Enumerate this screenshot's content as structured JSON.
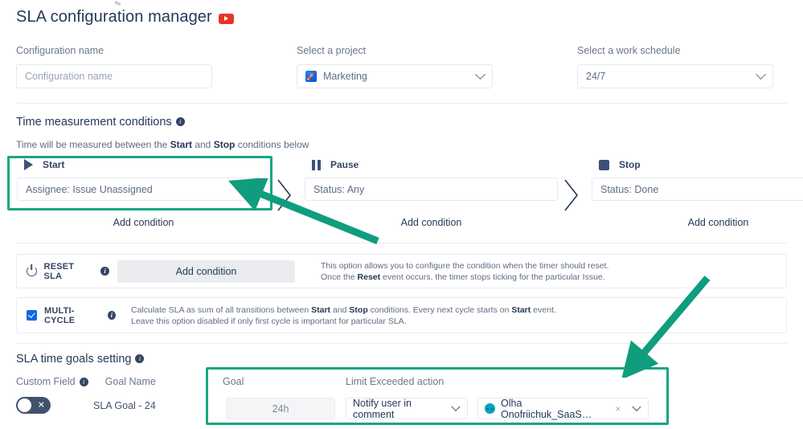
{
  "header": {
    "title": "SLA configuration manager",
    "video_icon": "youtube-icon"
  },
  "fields": {
    "configuration": {
      "label": "Configuration name",
      "placeholder": "Configuration name",
      "value": ""
    },
    "project": {
      "label": "Select a project",
      "value": "Marketing",
      "icon": "rocket-icon"
    },
    "schedule": {
      "label": "Select a work schedule",
      "value": "24/7"
    }
  },
  "time_measurement": {
    "title": "Time measurement conditions",
    "note_prefix": "Time will be measured between the ",
    "note_start": "Start",
    "note_mid": " and ",
    "note_stop": "Stop",
    "note_suffix": " conditions below",
    "columns": [
      {
        "name": "Start",
        "icon": "play-icon",
        "condition": "Assignee: Issue Unassigned",
        "add_condition": "Add condition"
      },
      {
        "name": "Pause",
        "icon": "pause-icon",
        "condition": "Status: Any",
        "add_condition": "Add condition"
      },
      {
        "name": "Stop",
        "icon": "stop-icon",
        "condition": "Status: Done",
        "add_condition": "Add condition"
      }
    ]
  },
  "reset_sla": {
    "label": "RESET SLA",
    "button": "Add condition",
    "desc_line1": "This option allows you to configure the condition when the timer should reset.",
    "desc_line2_a": "Once the ",
    "desc_line2_b": "Reset",
    "desc_line2_c": " event occurs, the timer stops ticking for the particular Issue."
  },
  "multi_cycle": {
    "label": "MULTI-CYCLE",
    "checked": true,
    "desc_line1_a": "Calculate SLA as sum of all transitions between ",
    "desc_line1_b": "Start",
    "desc_line1_c": " and ",
    "desc_line1_d": "Stop",
    "desc_line1_e": " conditions. Every next cycle starts on ",
    "desc_line1_f": "Start",
    "desc_line1_g": " event.",
    "desc_line2": "Leave this option disabled if only first cycle is important for particular SLA."
  },
  "sla_goals": {
    "title": "SLA time goals setting",
    "custom_field_label": "Custom Field",
    "goal_name_label": "Goal Name",
    "goal_label": "Goal",
    "limit_label": "Limit Exceeded action",
    "rows": [
      {
        "toggle_on": false,
        "goal_name": "SLA Goal - 24",
        "goal_value": "24h",
        "action": "Notify user in comment",
        "user": "Olha Onofriichuk_SaaS…",
        "clear": "×"
      }
    ]
  },
  "annotations": {
    "highlight_color": "#17a683",
    "arrow_color": "#0f9d7e"
  }
}
